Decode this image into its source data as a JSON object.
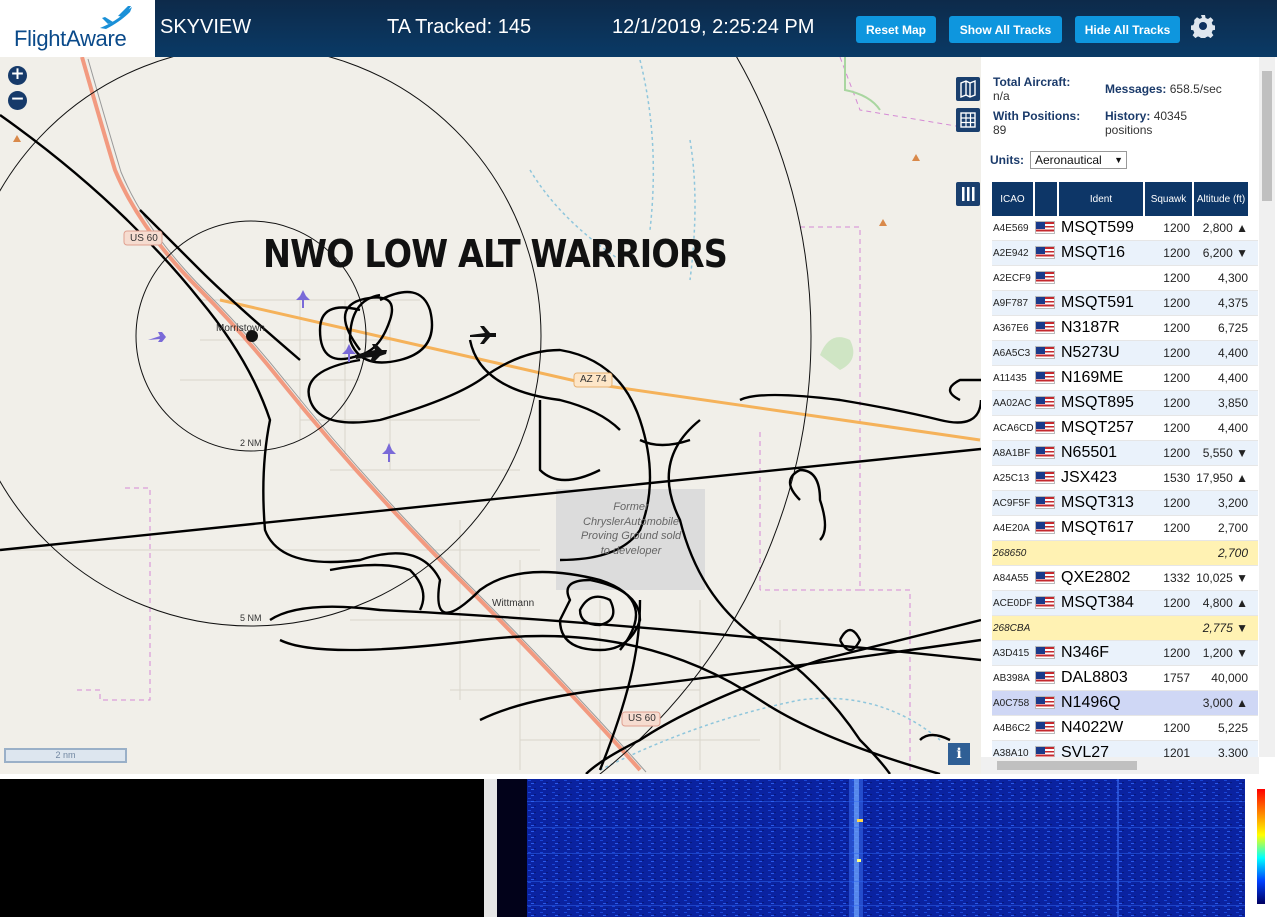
{
  "header": {
    "logo_text": "FlightAware",
    "app_name": "SKYVIEW",
    "ta_tracked": "TA Tracked: 145",
    "clock": "12/1/2019, 2:25:24 PM",
    "buttons": {
      "reset_map": "Reset Map",
      "show_all": "Show All Tracks",
      "hide_all": "Hide All Tracks"
    }
  },
  "map": {
    "overlay_title": "NWO LOW ALT WARRIORS",
    "zoom_in": "+",
    "zoom_out": "−",
    "scale_label": "2 nm",
    "info": "i",
    "labels": {
      "us60_a": "US 60",
      "us60_b": "US 60",
      "az74": "AZ 74",
      "morristown": "Morristown",
      "wittmann": "Wittmann",
      "ring_2nm": "2 NM",
      "ring_5nm": "5 NM",
      "former_area": "Former ChryslerAutomobile Proving Ground sold to developer"
    }
  },
  "panel": {
    "total_aircraft_label": "Total Aircraft:",
    "total_aircraft_value": "n/a",
    "messages_label": "Messages:",
    "messages_value": "658.5/sec",
    "with_positions_label": "With Positions:",
    "with_positions_value": "89",
    "history_label": "History:",
    "history_value": "40345 positions",
    "units_label": "Units:",
    "units_selected": "Aeronautical",
    "columns": [
      "ICAO",
      "",
      "Ident",
      "Squawk",
      "Altitude (ft)"
    ],
    "rows": [
      {
        "icao": "A4E569",
        "flag": true,
        "ident": "MSQT599",
        "squawk": "1200",
        "alt": "2,800 ▲",
        "style": "odd"
      },
      {
        "icao": "A2E942",
        "flag": true,
        "ident": "MSQT16",
        "squawk": "1200",
        "alt": "6,200 ▼",
        "style": "even"
      },
      {
        "icao": "A2ECF9",
        "flag": true,
        "ident": "",
        "squawk": "1200",
        "alt": "4,300",
        "style": "odd"
      },
      {
        "icao": "A9F787",
        "flag": true,
        "ident": "MSQT591",
        "squawk": "1200",
        "alt": "4,375",
        "style": "even"
      },
      {
        "icao": "A367E6",
        "flag": true,
        "ident": "N3187R",
        "squawk": "1200",
        "alt": "6,725",
        "style": "odd"
      },
      {
        "icao": "A6A5C3",
        "flag": true,
        "ident": "N5273U",
        "squawk": "1200",
        "alt": "4,400",
        "style": "even"
      },
      {
        "icao": "A11435",
        "flag": true,
        "ident": "N169ME",
        "squawk": "1200",
        "alt": "4,400",
        "style": "odd"
      },
      {
        "icao": "AA02AC",
        "flag": true,
        "ident": "MSQT895",
        "squawk": "1200",
        "alt": "3,850",
        "style": "even"
      },
      {
        "icao": "ACA6CD",
        "flag": true,
        "ident": "MSQT257",
        "squawk": "1200",
        "alt": "4,400",
        "style": "odd"
      },
      {
        "icao": "A8A1BF",
        "flag": true,
        "ident": "N65501",
        "squawk": "1200",
        "alt": "5,550 ▼",
        "style": "even"
      },
      {
        "icao": "A25C13",
        "flag": true,
        "ident": "JSX423",
        "squawk": "1530",
        "alt": "17,950 ▲",
        "style": "odd"
      },
      {
        "icao": "AC9F5F",
        "flag": true,
        "ident": "MSQT313",
        "squawk": "1200",
        "alt": "3,200",
        "style": "even"
      },
      {
        "icao": "A4E20A",
        "flag": true,
        "ident": "MSQT617",
        "squawk": "1200",
        "alt": "2,700",
        "style": "odd"
      },
      {
        "icao": "268650",
        "flag": false,
        "ident": "",
        "squawk": "",
        "alt": "2,700",
        "style": "tisb"
      },
      {
        "icao": "A84A55",
        "flag": true,
        "ident": "QXE2802",
        "squawk": "1332",
        "alt": "10,025 ▼",
        "style": "odd"
      },
      {
        "icao": "ACE0DF",
        "flag": true,
        "ident": "MSQT384",
        "squawk": "1200",
        "alt": "4,800 ▲",
        "style": "even"
      },
      {
        "icao": "268CBA",
        "flag": false,
        "ident": "",
        "squawk": "",
        "alt": "2,775 ▼",
        "style": "tisb"
      },
      {
        "icao": "A3D415",
        "flag": true,
        "ident": "N346F",
        "squawk": "1200",
        "alt": "1,200 ▼",
        "style": "even"
      },
      {
        "icao": "AB398A",
        "flag": true,
        "ident": "DAL8803",
        "squawk": "1757",
        "alt": "40,000",
        "style": "odd"
      },
      {
        "icao": "A0C758",
        "flag": true,
        "ident": "N1496Q",
        "squawk": "",
        "alt": "3,000 ▲",
        "style": "sel"
      },
      {
        "icao": "A4B6C2",
        "flag": true,
        "ident": "N4022W",
        "squawk": "1200",
        "alt": "5,225",
        "style": "odd"
      },
      {
        "icao": "A38A10",
        "flag": true,
        "ident": "SVL27",
        "squawk": "1201",
        "alt": "3,300",
        "style": "even"
      }
    ]
  },
  "icons": [
    "flightaware-plane-icon",
    "gear-icon",
    "map-icon",
    "grid-icon",
    "columns-icon",
    "info-icon"
  ]
}
